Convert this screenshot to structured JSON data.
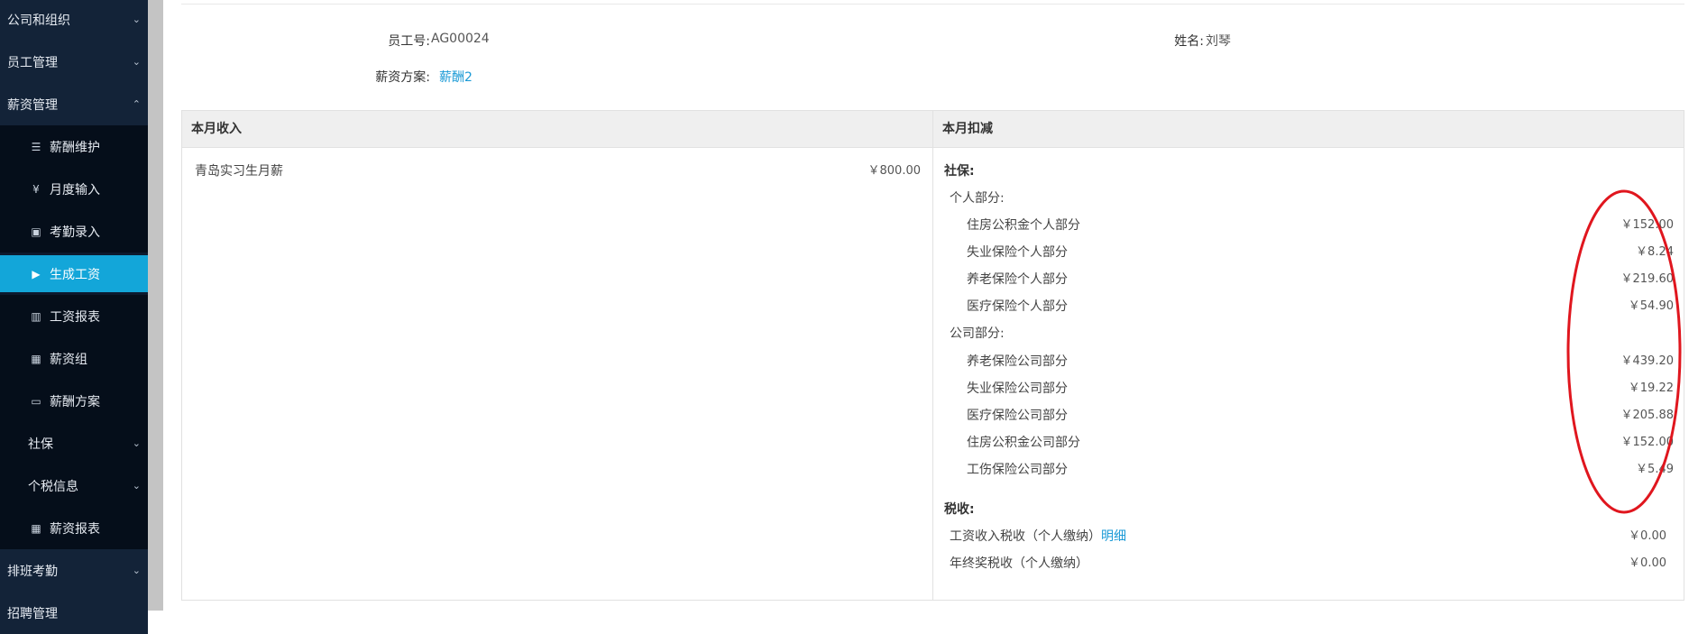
{
  "sidebar": {
    "items": [
      {
        "label": "公司和组织",
        "chevron": "⌄"
      },
      {
        "label": "员工管理",
        "chevron": "⌄"
      },
      {
        "label": "薪资管理",
        "chevron": "⌃"
      },
      {
        "label": "薪酬维护",
        "icon": "list-icon",
        "glyph": "☰"
      },
      {
        "label": "月度输入",
        "icon": "yen-circle-icon",
        "glyph": "¥"
      },
      {
        "label": "考勤录入",
        "icon": "calendar-icon",
        "glyph": "▣"
      },
      {
        "label": "生成工资",
        "icon": "play-circle-icon",
        "glyph": "▶"
      },
      {
        "label": "工资报表",
        "icon": "bar-chart-icon",
        "glyph": "▥"
      },
      {
        "label": "薪资组",
        "icon": "grid-icon",
        "glyph": "▦"
      },
      {
        "label": "薪酬方案",
        "icon": "card-icon",
        "glyph": "▭"
      },
      {
        "label": "社保",
        "chevron": "⌄"
      },
      {
        "label": "个税信息",
        "chevron": "⌄"
      },
      {
        "label": "薪资报表",
        "icon": "grid-icon",
        "glyph": "▦"
      },
      {
        "label": "排班考勤",
        "chevron": "⌄"
      },
      {
        "label": "招聘管理",
        "chevron": ""
      }
    ]
  },
  "info": {
    "emp_no_label": "员工号:",
    "emp_no": "AG00024",
    "name_label": "姓名:",
    "name": "刘琴",
    "plan_label": "薪资方案:",
    "plan": "薪酬2"
  },
  "income": {
    "header": "本月收入",
    "items": [
      {
        "label": "青岛实习生月薪",
        "amount": "￥800.00"
      }
    ]
  },
  "deduction": {
    "header": "本月扣减",
    "social_label": "社保:",
    "personal_label": "个人部分:",
    "personal": [
      {
        "label": "住房公积金个人部分",
        "amount": "￥152.00"
      },
      {
        "label": "失业保险个人部分",
        "amount": "￥8.24"
      },
      {
        "label": "养老保险个人部分",
        "amount": "￥219.60"
      },
      {
        "label": "医疗保险个人部分",
        "amount": "￥54.90"
      }
    ],
    "company_label": "公司部分:",
    "company": [
      {
        "label": "养老保险公司部分",
        "amount": "￥439.20"
      },
      {
        "label": "失业保险公司部分",
        "amount": "￥19.22"
      },
      {
        "label": "医疗保险公司部分",
        "amount": "￥205.88"
      },
      {
        "label": "住房公积金公司部分",
        "amount": "￥152.00"
      },
      {
        "label": "工伤保险公司部分",
        "amount": "￥5.49"
      }
    ],
    "tax_label": "税收:",
    "tax": [
      {
        "label": "工资收入税收（个人缴纳）",
        "link": "明细",
        "amount": "￥0.00"
      },
      {
        "label": "年终奖税收（个人缴纳）",
        "amount": "￥0.00"
      }
    ]
  },
  "colors": {
    "accent": "#13a6d9",
    "sidebar": "#0d1a2e",
    "annotation": "#e0161e"
  }
}
